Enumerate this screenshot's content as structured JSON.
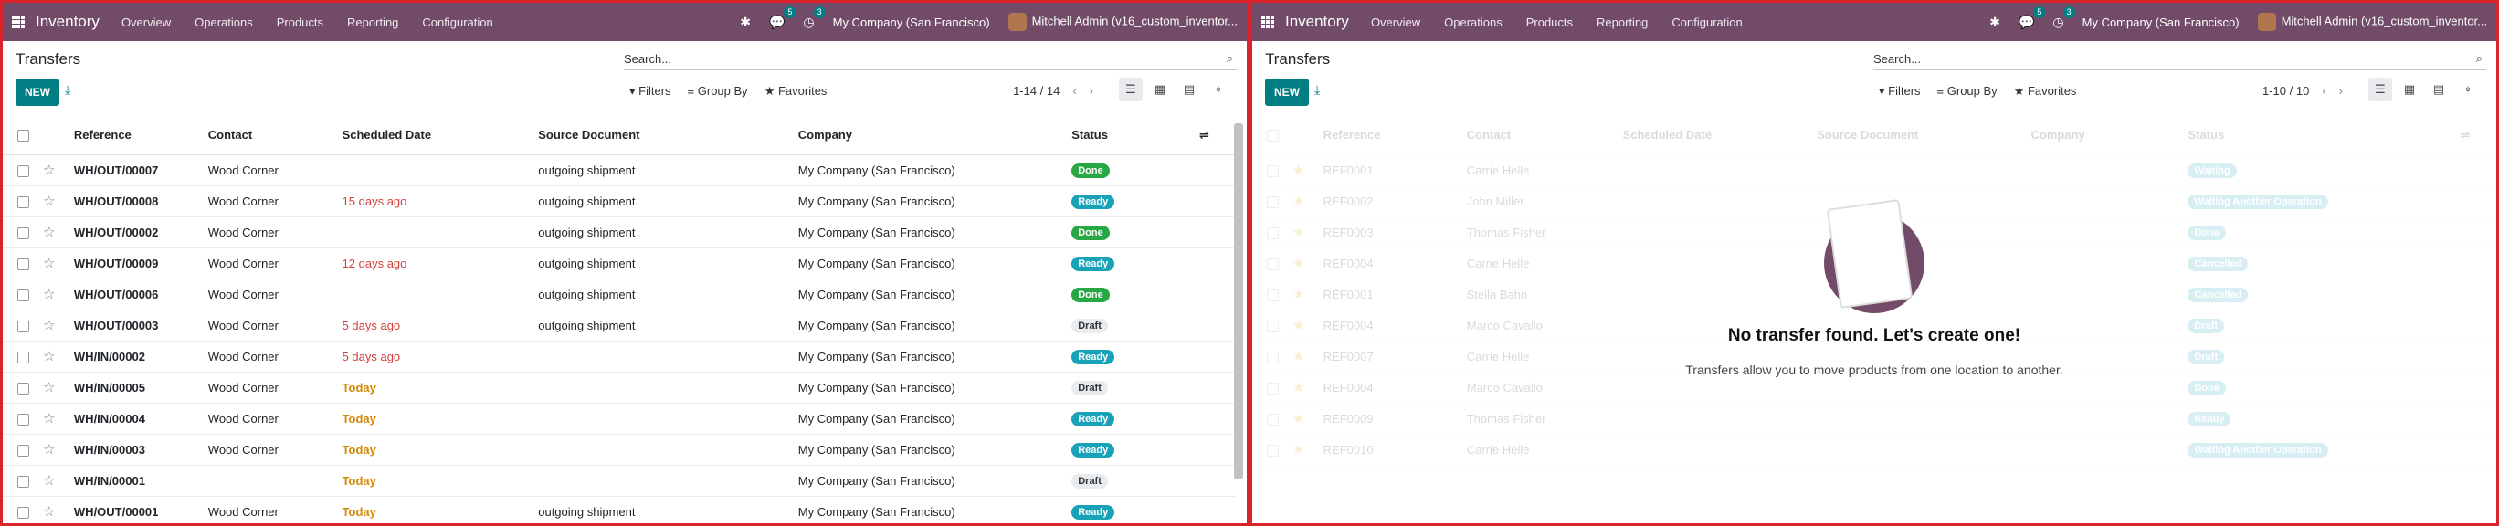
{
  "nav": {
    "app": "Inventory",
    "menus": [
      "Overview",
      "Operations",
      "Products",
      "Reporting",
      "Configuration"
    ],
    "chat_badge": "5",
    "activity_badge": "3",
    "company": "My Company (San Francisco)",
    "user": "Mitchell Admin (v16_custom_inventor..."
  },
  "cp": {
    "title": "Transfers",
    "new": "NEW",
    "search_placeholder": "Search...",
    "filters": "Filters",
    "groupby": "Group By",
    "favorites": "Favorites"
  },
  "left": {
    "pager": "1-14 / 14",
    "headers": [
      "Reference",
      "Contact",
      "Scheduled Date",
      "Source Document",
      "Company",
      "Status"
    ],
    "rows": [
      {
        "ref": "WH/OUT/00007",
        "contact": "Wood Corner",
        "date": "",
        "date_style": "",
        "source": "outgoing shipment",
        "company": "My Company (San Francisco)",
        "status": "Done",
        "st": "done"
      },
      {
        "ref": "WH/OUT/00008",
        "contact": "Wood Corner",
        "date": "15 days ago",
        "date_style": "red",
        "source": "outgoing shipment",
        "company": "My Company (San Francisco)",
        "status": "Ready",
        "st": "ready"
      },
      {
        "ref": "WH/OUT/00002",
        "contact": "Wood Corner",
        "date": "",
        "date_style": "",
        "source": "outgoing shipment",
        "company": "My Company (San Francisco)",
        "status": "Done",
        "st": "done"
      },
      {
        "ref": "WH/OUT/00009",
        "contact": "Wood Corner",
        "date": "12 days ago",
        "date_style": "red",
        "source": "outgoing shipment",
        "company": "My Company (San Francisco)",
        "status": "Ready",
        "st": "ready"
      },
      {
        "ref": "WH/OUT/00006",
        "contact": "Wood Corner",
        "date": "",
        "date_style": "",
        "source": "outgoing shipment",
        "company": "My Company (San Francisco)",
        "status": "Done",
        "st": "done"
      },
      {
        "ref": "WH/OUT/00003",
        "contact": "Wood Corner",
        "date": "5 days ago",
        "date_style": "red",
        "source": "outgoing shipment",
        "company": "My Company (San Francisco)",
        "status": "Draft",
        "st": "draft"
      },
      {
        "ref": "WH/IN/00002",
        "contact": "Wood Corner",
        "date": "5 days ago",
        "date_style": "red",
        "source": "",
        "company": "My Company (San Francisco)",
        "status": "Ready",
        "st": "ready"
      },
      {
        "ref": "WH/IN/00005",
        "contact": "Wood Corner",
        "date": "Today",
        "date_style": "orange",
        "source": "",
        "company": "My Company (San Francisco)",
        "status": "Draft",
        "st": "draft"
      },
      {
        "ref": "WH/IN/00004",
        "contact": "Wood Corner",
        "date": "Today",
        "date_style": "orange",
        "source": "",
        "company": "My Company (San Francisco)",
        "status": "Ready",
        "st": "ready"
      },
      {
        "ref": "WH/IN/00003",
        "contact": "Wood Corner",
        "date": "Today",
        "date_style": "orange",
        "source": "",
        "company": "My Company (San Francisco)",
        "status": "Ready",
        "st": "ready"
      },
      {
        "ref": "WH/IN/00001",
        "contact": "",
        "date": "Today",
        "date_style": "orange",
        "source": "",
        "company": "My Company (San Francisco)",
        "status": "Draft",
        "st": "draft"
      },
      {
        "ref": "WH/OUT/00001",
        "contact": "Wood Corner",
        "date": "Today",
        "date_style": "orange",
        "source": "outgoing shipment",
        "company": "My Company (San Francisco)",
        "status": "Ready",
        "st": "ready"
      }
    ]
  },
  "right": {
    "pager": "1-10 / 10",
    "headers": [
      "Reference",
      "Contact",
      "Scheduled Date",
      "Source Document",
      "Company",
      "Status"
    ],
    "ghost_rows": [
      {
        "ref": "REF0001",
        "contact": "Carrie Helle",
        "status": "Waiting"
      },
      {
        "ref": "REF0002",
        "contact": "John Miller",
        "status": "Waiting Another Operation"
      },
      {
        "ref": "REF0003",
        "contact": "Thomas Fisher",
        "status": "Done"
      },
      {
        "ref": "REF0004",
        "contact": "Carrie Helle",
        "status": "Cancelled"
      },
      {
        "ref": "REF0001",
        "contact": "Stella Bahn",
        "status": "Cancelled"
      },
      {
        "ref": "REF0004",
        "contact": "Marco Cavallo",
        "status": "Draft"
      },
      {
        "ref": "REF0007",
        "contact": "Carrie Helle",
        "status": "Draft"
      },
      {
        "ref": "REF0004",
        "contact": "Marco Cavallo",
        "status": "Done"
      },
      {
        "ref": "REF0009",
        "contact": "Thomas Fisher",
        "status": "Ready"
      },
      {
        "ref": "REF0010",
        "contact": "Carrie Helle",
        "status": "Waiting Another Operation"
      }
    ],
    "empty_title": "No transfer found. Let's create one!",
    "empty_text": "Transfers allow you to move products from one location to another."
  }
}
